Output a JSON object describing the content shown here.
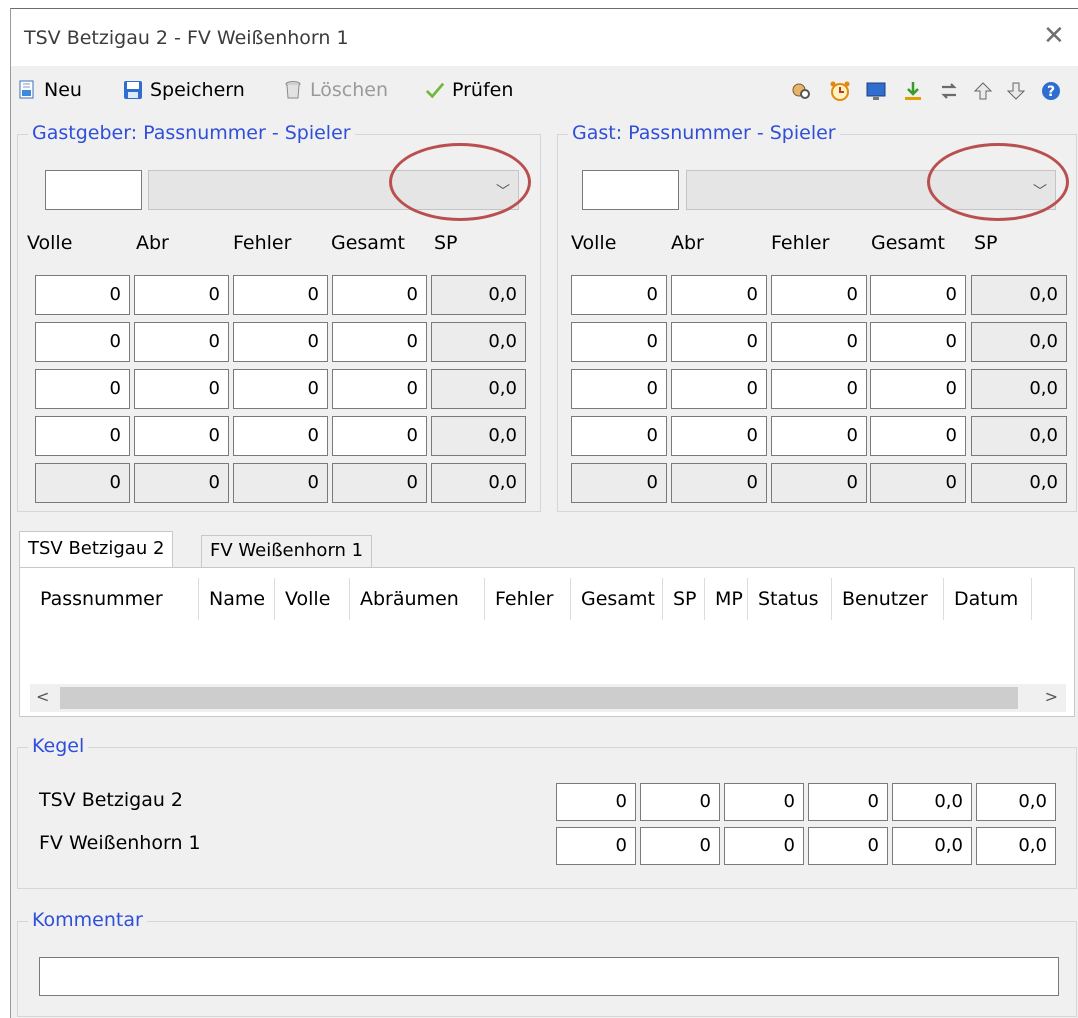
{
  "window": {
    "title": "TSV Betzigau 2 - FV Weißenhorn 1",
    "close_glyph": "✕"
  },
  "toolbar": {
    "new_label": "Neu",
    "save_label": "Speichern",
    "delete_label": "Löschen",
    "check_label": "Prüfen",
    "right_icons": [
      "user-search-icon",
      "alarm-clock-icon",
      "monitor-icon",
      "download-icon",
      "swap-icon",
      "arrow-up-icon",
      "arrow-down-icon",
      "help-icon"
    ]
  },
  "host_group": {
    "label": "Gastgeber: Passnummer - Spieler",
    "columns": [
      "Volle",
      "Abr",
      "Fehler",
      "Gesamt",
      "SP"
    ],
    "rows": [
      [
        "0",
        "0",
        "0",
        "0",
        "0,0"
      ],
      [
        "0",
        "0",
        "0",
        "0",
        "0,0"
      ],
      [
        "0",
        "0",
        "0",
        "0",
        "0,0"
      ],
      [
        "0",
        "0",
        "0",
        "0",
        "0,0"
      ],
      [
        "0",
        "0",
        "0",
        "0",
        "0,0"
      ]
    ]
  },
  "guest_group": {
    "label": "Gast: Passnummer - Spieler",
    "columns": [
      "Volle",
      "Abr",
      "Fehler",
      "Gesamt",
      "SP"
    ],
    "rows": [
      [
        "0",
        "0",
        "0",
        "0",
        "0,0"
      ],
      [
        "0",
        "0",
        "0",
        "0",
        "0,0"
      ],
      [
        "0",
        "0",
        "0",
        "0",
        "0,0"
      ],
      [
        "0",
        "0",
        "0",
        "0",
        "0,0"
      ],
      [
        "0",
        "0",
        "0",
        "0",
        "0,0"
      ]
    ]
  },
  "tabs": [
    {
      "label": "TSV Betzigau 2",
      "active": true
    },
    {
      "label": "FV Weißenhorn 1",
      "active": false
    }
  ],
  "table": {
    "headers": [
      "Passnummer",
      "Name",
      "Volle",
      "Abräumen",
      "Fehler",
      "Gesamt",
      "SP",
      "MP",
      "Status",
      "Benutzer",
      "Datum"
    ],
    "rows": []
  },
  "scroll": {
    "left": "<",
    "right": ">"
  },
  "kegel": {
    "label": "Kegel",
    "rows": [
      {
        "team": "TSV Betzigau 2",
        "values": [
          "0",
          "0",
          "0",
          "0",
          "0,0",
          "0,0"
        ]
      },
      {
        "team": "FV Weißenhorn 1",
        "values": [
          "0",
          "0",
          "0",
          "0",
          "0,0",
          "0,0"
        ]
      }
    ]
  },
  "comment": {
    "label": "Kommentar",
    "value": ""
  },
  "colors": {
    "group_label": "#2f4fd8",
    "highlight_circle": "#b9504f",
    "window_bg": "#f0f0f0"
  }
}
